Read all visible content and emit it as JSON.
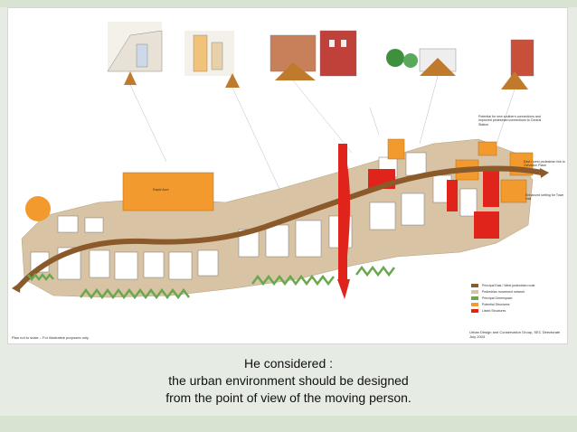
{
  "caption": {
    "line1": "He considered :",
    "line2": "the urban environment should be designed",
    "line3": "from the point of view of the moving person."
  },
  "plan": {
    "footer_left": "Plan not to scale – For illustrative purposes only",
    "credit_line1": "Urban Design and Conservation Group, SEC Directorate",
    "credit_line2": "July 2003",
    "labels": {
      "library": "Rapid Acre",
      "east_west": "East / west pedestrian link to Clevedon Place",
      "entrance": "Enhanced setting for Town Hall",
      "potential_links": "Potential for new southern connections and improved pedestrian connections to Central Station"
    },
    "legend": [
      {
        "label": "Principal East / West pedestrian route",
        "color": "#8b5a2b"
      },
      {
        "label": "Pedestrian movement network",
        "color": "#d9c3a5"
      },
      {
        "label": "Principal Greenspace",
        "color": "#6aa84f"
      },
      {
        "label": "Potential Structures",
        "color": "#f29a2e"
      },
      {
        "label": "Listed Structures",
        "color": "#e0241b"
      }
    ]
  },
  "colors": {
    "route": "#8b5a2b",
    "landmark_red": "#e0241b",
    "orange": "#f29a2e",
    "green": "#6aa84f",
    "paving": "#d9c3a5"
  }
}
